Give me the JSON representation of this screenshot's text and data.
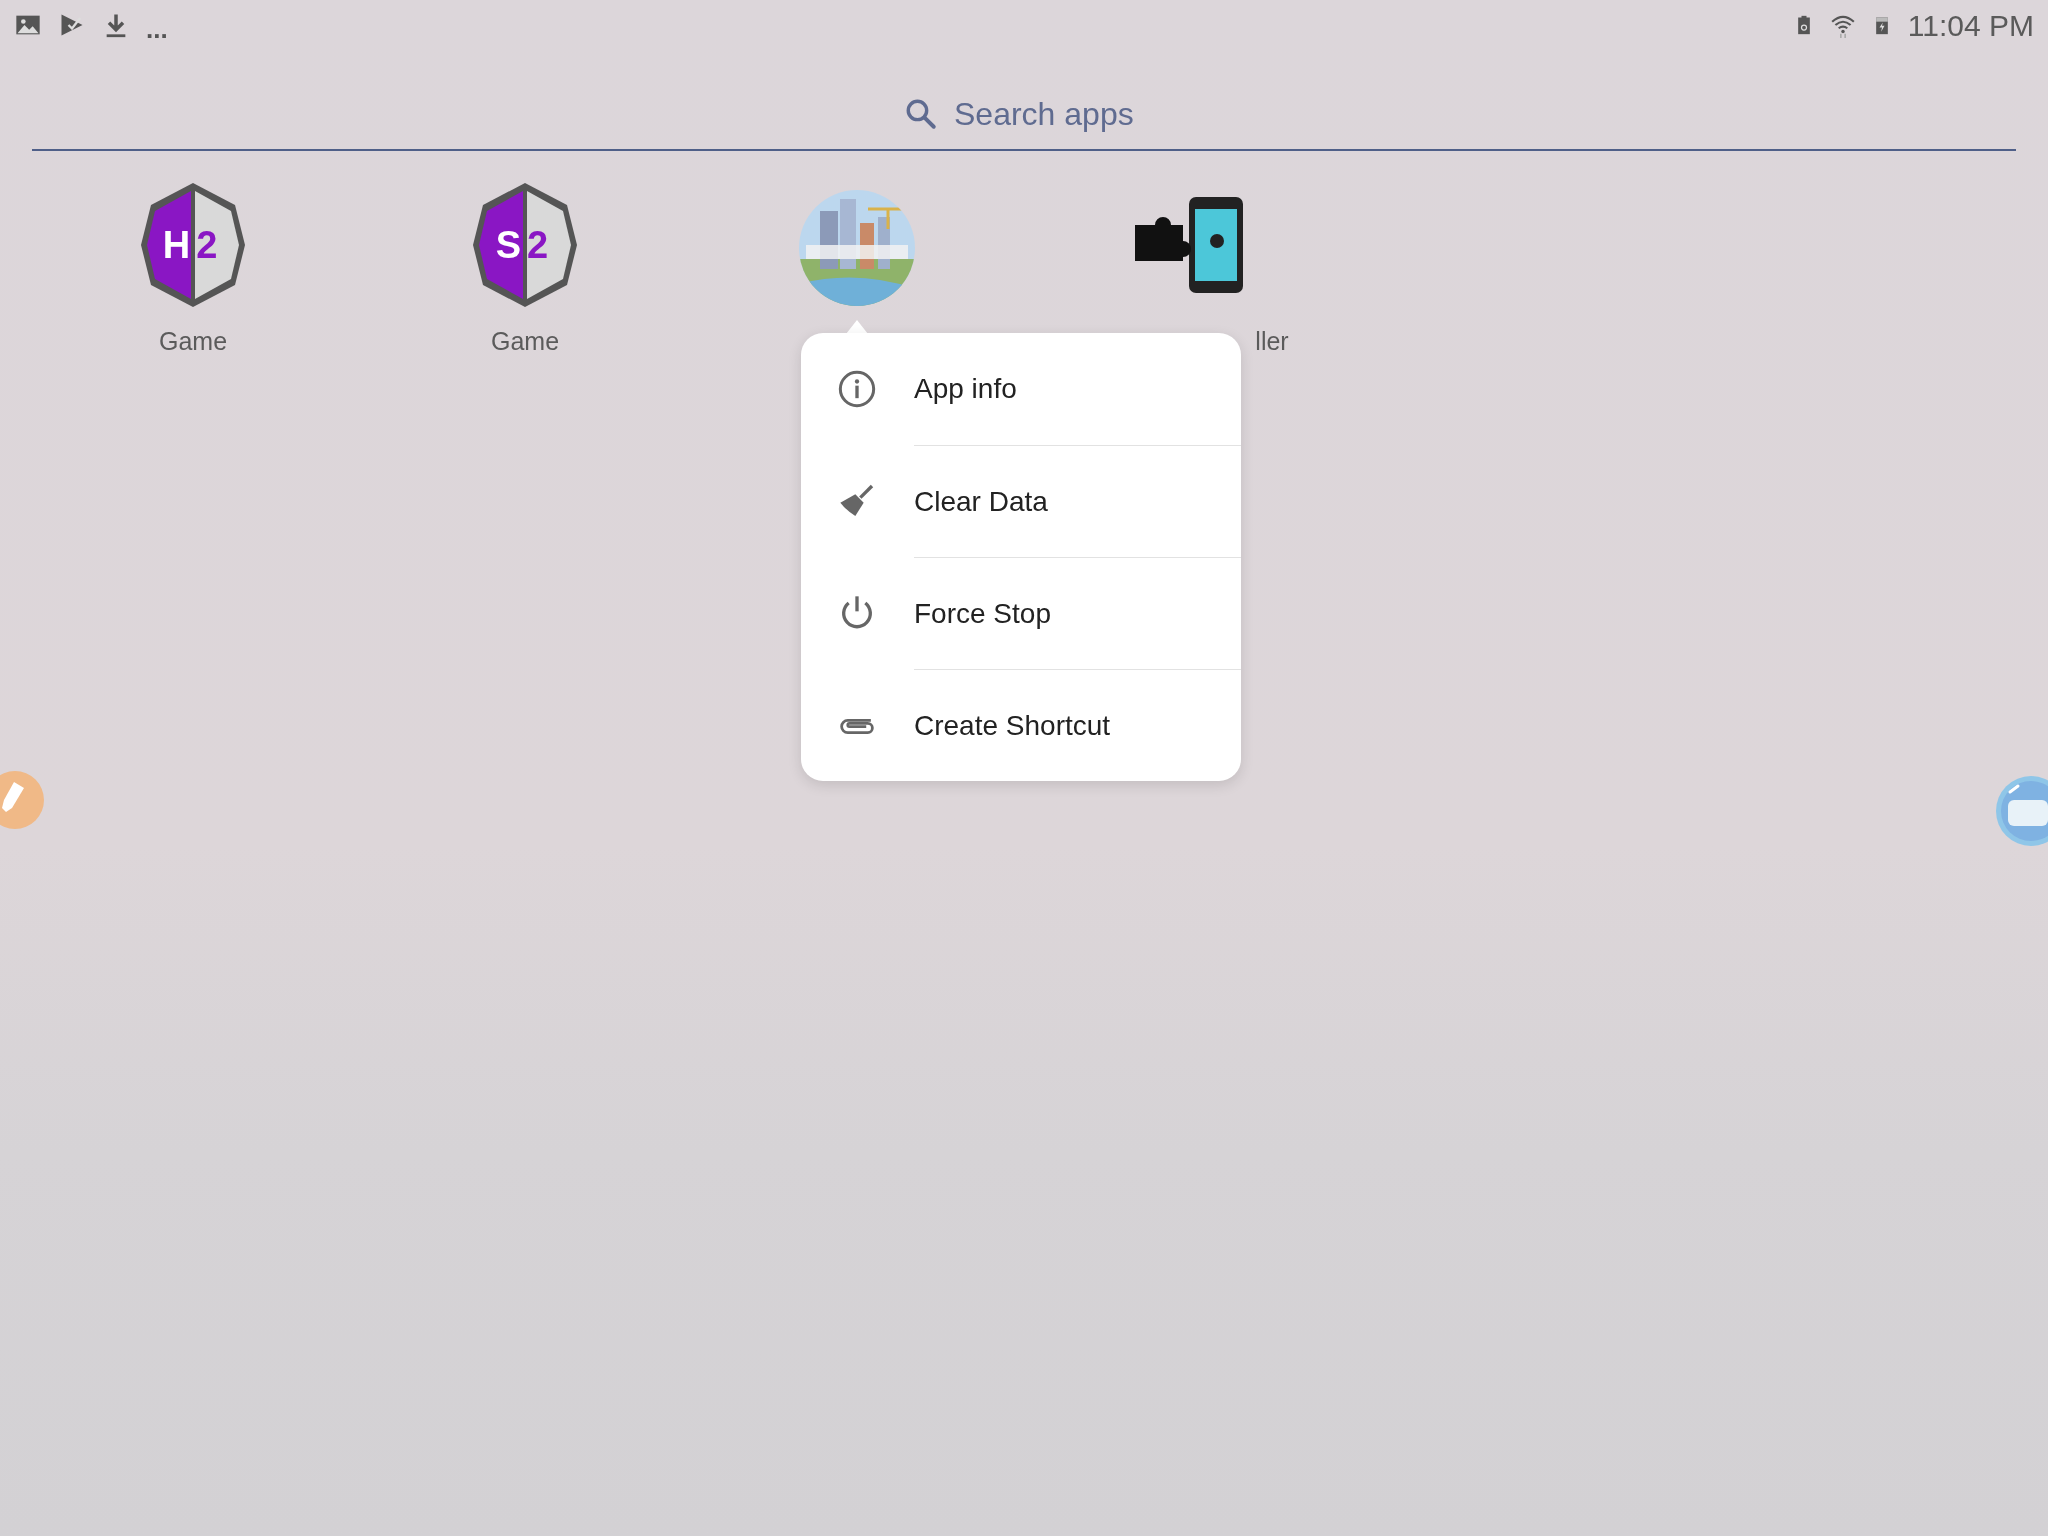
{
  "status_bar": {
    "overflow": "...",
    "time": "11:04 PM"
  },
  "search": {
    "placeholder": "Search apps"
  },
  "apps": [
    {
      "kind": "shield",
      "logo_text": "H2",
      "label": "Game"
    },
    {
      "kind": "shield",
      "logo_text": "S2",
      "label": "Game"
    },
    {
      "kind": "picture"
    },
    {
      "kind": "puzzle",
      "label": "ller"
    }
  ],
  "menu": {
    "items": [
      {
        "kind": "info",
        "label": "App info"
      },
      {
        "kind": "clear",
        "label": "Clear Data"
      },
      {
        "kind": "stop",
        "label": "Force Stop"
      },
      {
        "kind": "shortcut",
        "label": "Create Shortcut"
      }
    ]
  }
}
